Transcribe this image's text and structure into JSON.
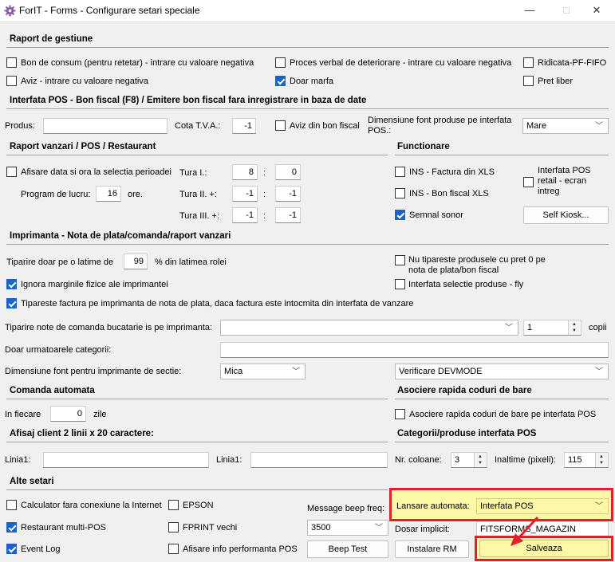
{
  "window": {
    "title": "ForIT - Forms - Configurare setari speciale",
    "min": "—",
    "max": "□",
    "close": "✕"
  },
  "raport_gestiune": {
    "title": "Raport de gestiune",
    "bon_consum": "Bon de consum (pentru retetar) - intrare cu valoare negativa",
    "aviz": "Aviz - intrare cu valoare negativa",
    "proces_verbal": "Proces verbal de deteriorare - intrare cu valoare negativa",
    "doar_marfa": "Doar marfa",
    "ridicata": "Ridicata-PF-FIFO",
    "pret_liber": "Pret liber"
  },
  "interfata_pos": {
    "title": "Interfata POS - Bon fiscal (F8) / Emitere bon fiscal fara inregistrare in baza de date",
    "produs_label": "Produs:",
    "produs_value": "",
    "cota_label": "Cota T.V.A.:",
    "cota_value": "-1",
    "aviz_bon": "Aviz din bon fiscal",
    "dim_font_label": "Dimensiune font produse pe interfata POS.:",
    "dim_font_value": "Mare"
  },
  "raport_vanzari": {
    "title": "Raport vanzari / POS / Restaurant",
    "afisare_data": "Afisare data si ora la selectia perioadei",
    "program_label": "Program de lucru:",
    "program_value": "16",
    "ore": "ore.",
    "tura1_label": "Tura I.:",
    "tura1_a": "8",
    "tura1_b": "0",
    "tura2_label": "Tura II. +:",
    "tura2_a": "-1",
    "tura2_b": "-1",
    "tura3_label": "Tura III. +:",
    "tura3_a": "-1",
    "tura3_b": "-1",
    "colon": ":"
  },
  "functionare": {
    "title": "Functionare",
    "ins_xls": "INS - Factura din XLS",
    "ins_bon": "INS - Bon fiscal XLS",
    "semnal": "Semnal sonor",
    "interfata_retail": "Interfata POS retail - ecran intreg",
    "self_kiosk": "Self Kiosk..."
  },
  "imprimanta": {
    "title": "Imprimanta - Nota de plata/comanda/raport vanzari",
    "tiparire_label": "Tiparire doar pe o latime de",
    "tiparire_value": "99",
    "tiparire_suffix": "% din latimea rolei",
    "ignora": "Ignora marginile fizice ale imprimantei",
    "nu_tipareste": "Nu tipareste produsele cu pret 0 pe nota de plata/bon fiscal",
    "interfata_fly": "Interfata selectie produse - fly",
    "tipareste_factura": "Tipareste factura pe imprimanta de nota de plata, daca factura este intocmita din interfata de vanzare",
    "note_label": "Tiparire note de comanda bucatarie is pe imprimanta:",
    "note_value": "",
    "copii_value": "1",
    "copii_label": "copii",
    "categorii_label": "Doar urmatoarele categorii:",
    "categorii_value": "",
    "dim_font_sectie_label": "Dimensiune font pentru imprimante de sectie:",
    "dim_font_sectie_value": "Mica",
    "verificare_value": "Verificare DEVMODE"
  },
  "comanda_automata": {
    "title": "Comanda automata",
    "in_fiecare": "In fiecare",
    "value": "0",
    "zile": "zile"
  },
  "asociere": {
    "title": "Asociere rapida coduri de bare",
    "option": "Asociere rapida coduri de bare pe interfata POS"
  },
  "afisaj": {
    "title": "Afisaj client 2 linii x 20 caractere:",
    "linia1_label": "Linia1:",
    "linia1_value": "",
    "linia2_label": "Linia1:",
    "linia2_value": ""
  },
  "categorii": {
    "title": "Categorii/produse interfata POS",
    "nr_coloane_label": "Nr. coloane:",
    "nr_coloane_value": "3",
    "inaltime_label": "Inaltime (pixeli):",
    "inaltime_value": "115"
  },
  "alte_setari": {
    "title": "Alte setari",
    "calculator": "Calculator fara conexiune la Internet",
    "epson": "EPSON",
    "message_beep_label": "Message beep freq:",
    "message_beep_value": "3500",
    "restaurant": "Restaurant multi-POS",
    "fprint": "FPRINT vechi",
    "event_log": "Event Log",
    "afisare_info": "Afisare info performanta POS",
    "beep_test": "Beep Test",
    "instalare_rm": "Instalare RM",
    "lansare_label": "Lansare automata:",
    "lansare_value": "Interfata POS",
    "dosar_label": "Dosar implicit:",
    "dosar_value": "FITSFORMS_MAGAZIN",
    "salveaza": "Salveaza"
  },
  "colors": {
    "accent": "#1a63c9",
    "highlight_border": "#e0202a",
    "highlight_fill": "#fdf7a8",
    "arrow": "#e0202a"
  }
}
